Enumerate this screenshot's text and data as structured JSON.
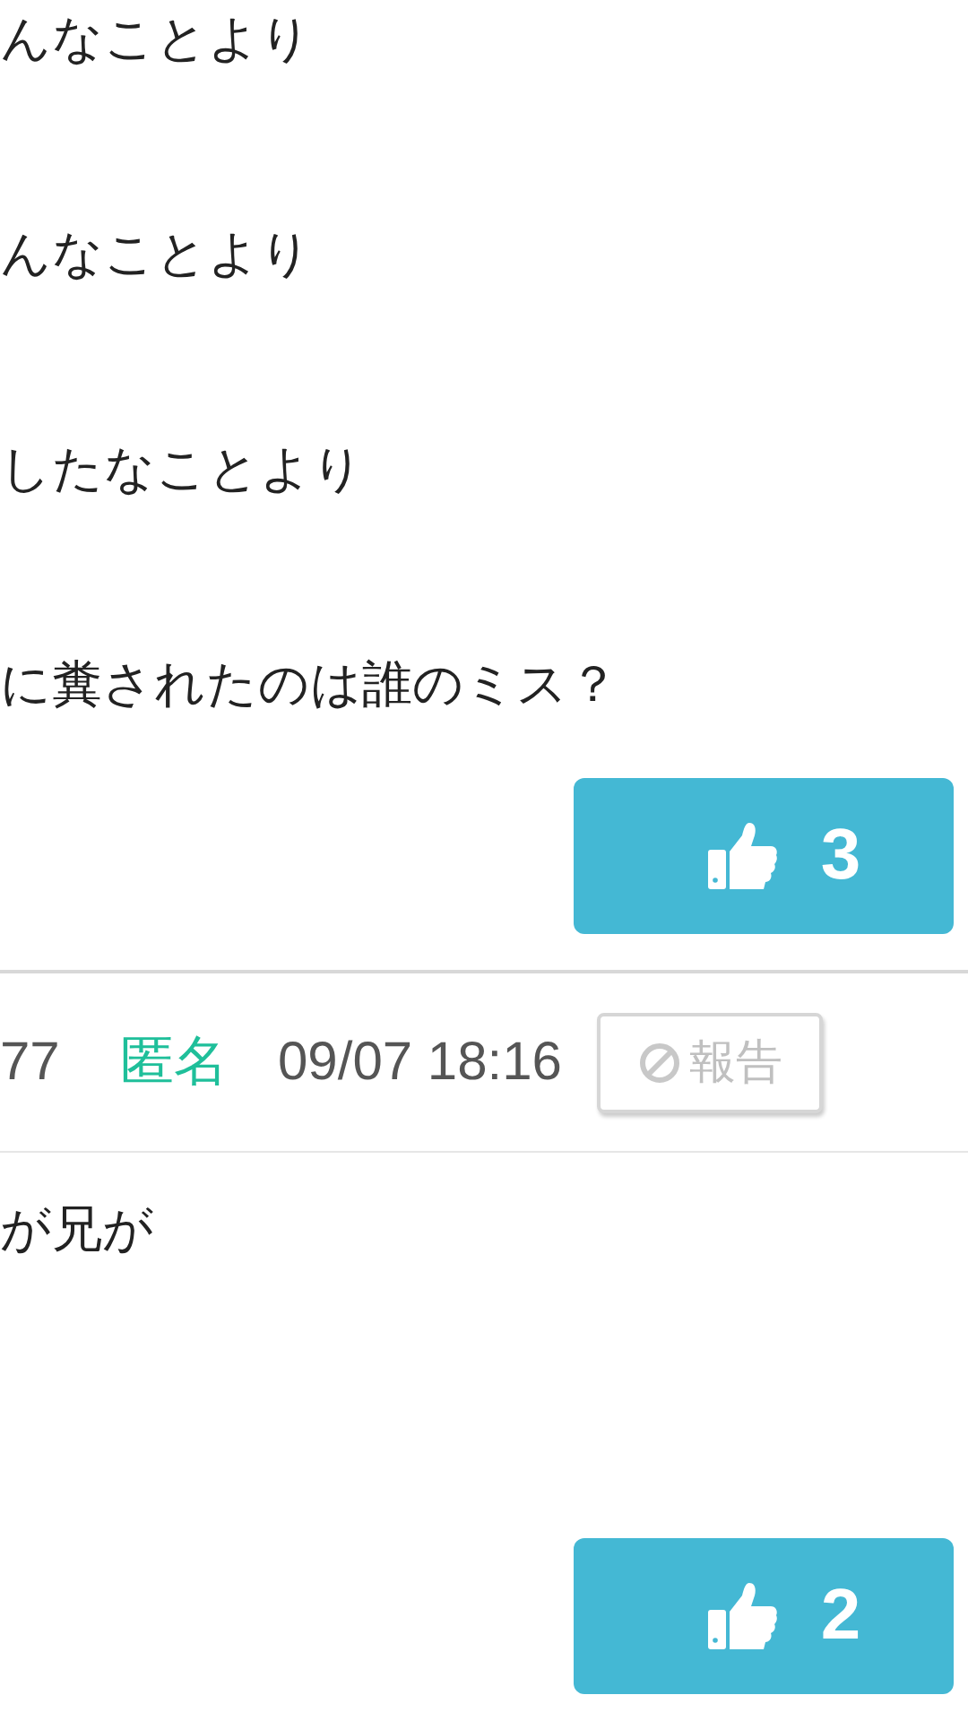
{
  "posts": [
    {
      "lines": [
        "んなことより",
        "んなことより",
        "したなことより",
        "に糞されたのは誰のミス？"
      ],
      "likes": "3"
    },
    {
      "number": "77",
      "name": "匿名",
      "date": "09/07 18:16",
      "report": "報告",
      "lines": [
        "が兄が"
      ],
      "likes": "2"
    }
  ]
}
